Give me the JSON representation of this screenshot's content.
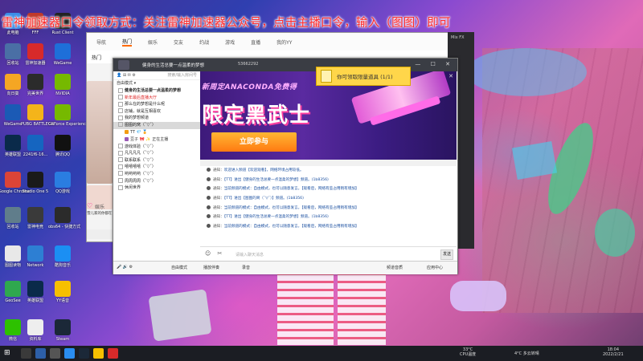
{
  "overlay_notice": "雷神加速器口令领取方式：关注雷神加速器公众号，点击主播口令，输入（图图）即可",
  "desktop_icons": [
    {
      "label": "此电脑",
      "icon": "computer-icon",
      "color": "#3b8ee8"
    },
    {
      "label": "FFF",
      "icon": "app-icon",
      "color": "#c0392b"
    },
    {
      "label": "Rust Client",
      "icon": "rust-icon",
      "color": "#222222"
    },
    {
      "label": "回收站",
      "icon": "recycle-bin-icon",
      "color": "#4a6fa5"
    },
    {
      "label": "雷神加速器",
      "icon": "leishen-icon",
      "color": "#d72a2a"
    },
    {
      "label": "WeGame",
      "icon": "wegame-icon",
      "color": "#1e6fd9"
    },
    {
      "label": "向日葵",
      "icon": "sunflower-icon",
      "color": "#f5a623"
    },
    {
      "label": "完美世界",
      "icon": "perfect-icon",
      "color": "#2b2b2b"
    },
    {
      "label": "NVIDIA",
      "icon": "nvidia-icon",
      "color": "#76b900"
    },
    {
      "label": "WeGame",
      "icon": "wegame-icon",
      "color": "#1b5ab5"
    },
    {
      "label": "PUBG BATTLEGR...",
      "icon": "pubg-icon",
      "color": "#f4b41a"
    },
    {
      "label": "GeForce Experience",
      "icon": "geforce-icon",
      "color": "#76b900"
    },
    {
      "label": "英雄联盟",
      "icon": "lol-icon",
      "color": "#0a2a4a"
    },
    {
      "label": "2241f6-16...",
      "icon": "file-icon",
      "color": "#1565c0"
    },
    {
      "label": "腾讯QQ",
      "icon": "qq-icon",
      "color": "#111111"
    },
    {
      "label": "Google Chrome",
      "icon": "chrome-icon",
      "color": "#db4437"
    },
    {
      "label": "Studio One 5",
      "icon": "studio-icon",
      "color": "#1a1a1a"
    },
    {
      "label": "QQ游戏",
      "icon": "qqgame-icon",
      "color": "#2a7de1"
    },
    {
      "label": "回收站",
      "icon": "bin-icon",
      "color": "#607d8b"
    },
    {
      "label": "雷神电竞",
      "icon": "app-icon",
      "color": "#3a3a3a"
    },
    {
      "label": "obs64 - 快捷方式",
      "icon": "obs-icon",
      "color": "#2b2b2b"
    },
    {
      "label": "图图读物",
      "icon": "doc-icon",
      "color": "#e8e8e8"
    },
    {
      "label": "Network",
      "icon": "network-icon",
      "color": "#2d7fd3"
    },
    {
      "label": "酷狗音乐",
      "icon": "kugou-icon",
      "color": "#1b8ff3"
    },
    {
      "label": "GeoSee",
      "icon": "geo-icon",
      "color": "#2fa84f"
    },
    {
      "label": "英雄联盟",
      "icon": "lol-icon",
      "color": "#0a2a4a"
    },
    {
      "label": "YY语音",
      "icon": "yy-icon",
      "color": "#f6c000"
    },
    {
      "label": "微信",
      "icon": "wechat-icon",
      "color": "#2dc100"
    },
    {
      "label": "资料库",
      "icon": "doc-icon",
      "color": "#eeeeee"
    },
    {
      "label": "Steam",
      "icon": "steam-icon",
      "color": "#1b2838"
    },
    {
      "label": "腾讯会议",
      "icon": "meeting-icon",
      "color": "#2a6de1"
    },
    {
      "label": "YY开播",
      "icon": "yy-live-icon",
      "color": "#f6c000"
    },
    {
      "label": "小黑本",
      "icon": "doc-icon",
      "color": "#f2f2f2"
    }
  ],
  "bg_window": {
    "nav": [
      "导航",
      "热门",
      "娱乐",
      "交友",
      "约战",
      "游戏",
      "直播",
      "我的YY"
    ],
    "active_nav": "热门",
    "subnav": "热门",
    "cards": [
      "我的频道",
      "娱乐",
      "管理中心"
    ],
    "thumb_caption": "雪儿家的你都在",
    "entertainment_label": "娱乐"
  },
  "dark_panel": {
    "title": "Mix FX"
  },
  "yy_window": {
    "title": "健身的生活总要一点温柔的梦想",
    "room_id": "53662292",
    "controls": "— ☐ ✕",
    "sidebar": {
      "tools": "👤 ⊞ ✉ ⚙",
      "search_hint": "搜索/输入房间号",
      "mode": "自由模式",
      "items": [
        {
          "text": "健身的生活总要一点温柔的梦想",
          "style": "bold"
        },
        {
          "text": "新年最后直播大厅",
          "style": "red"
        },
        {
          "text": "那么在的梦想是什么呢",
          "style": "normal"
        },
        {
          "text": "店铺，就是互相喜欢",
          "style": "normal"
        },
        {
          "text": "我的梦想频道",
          "style": "normal"
        },
        {
          "text": "图图的窝（ˇ▽ˇ）",
          "style": "sel"
        }
      ],
      "users": [
        {
          "name": "TT",
          "badges": "💎 🏅",
          "color": "#f39c12"
        },
        {
          "name": "豆子 🎀 ✨  正在主播",
          "badges": "",
          "color": "#9b59b6"
        }
      ],
      "more_items": [
        "游戏体验（ˇ▽ˇ）",
        "凡凡凡凡（ˇ▽ˇ）",
        "联系联系（ˇ▽ˇ）",
        "嘻嘻嘻嘻（ˇ▽ˇ）",
        "哟哟哟哟（ˇ▽ˇ）",
        "周周周周（ˇ▽ˇ）",
        "休闲世界"
      ]
    },
    "banner": {
      "subtitle": "新周定ANACONDA免费得",
      "headline": "限定黑武士",
      "button": "立即参与"
    },
    "popup": {
      "text": "你可领取限量道具 (1/1)"
    },
    "messages": [
      {
        "prefix": "通知：",
        "text": "欢迎进入频道【欢迎观看】，网络环境占用较低。"
      },
      {
        "prefix": "通知：",
        "text": "【TT】进出【健身的生活总要一点温柔的梦想】频道。(1b8356)"
      },
      {
        "prefix": "通知：",
        "text": "当前频道的模式：自由模式，也可以随意发言。【观看后，网络有些占用稍有增加】"
      },
      {
        "prefix": "通知：",
        "text": "【TT】进出【图图的窝（ˇ▽ˇ）】频道。(1b8356)"
      },
      {
        "prefix": "通知：",
        "text": "当前频道的模式：自由模式，也可以随意发言。【观看后，网络有些占用稍有增加】"
      },
      {
        "prefix": "通知：",
        "text": "【TT】进出【健身的生活总要一点温柔的梦想】频道。(1b8356)"
      },
      {
        "prefix": "通知：",
        "text": "当前频道的模式：自由模式，也可以随意发言。【观看后，网络有些占用稍有增加】"
      }
    ],
    "input": {
      "placeholder": "请输入聊天消息",
      "send": "发送"
    },
    "bottom": {
      "free_mode": "自由模式",
      "broadcast": "播放伴奏",
      "record": "录音",
      "quality": "频道音质",
      "app_center": "应用中心"
    }
  },
  "taskbar": {
    "temp": "33°C",
    "cpu_label": "CPU温度",
    "weather": "4°C  多云转晴",
    "time": "18:04",
    "date": "2022/2/21"
  }
}
